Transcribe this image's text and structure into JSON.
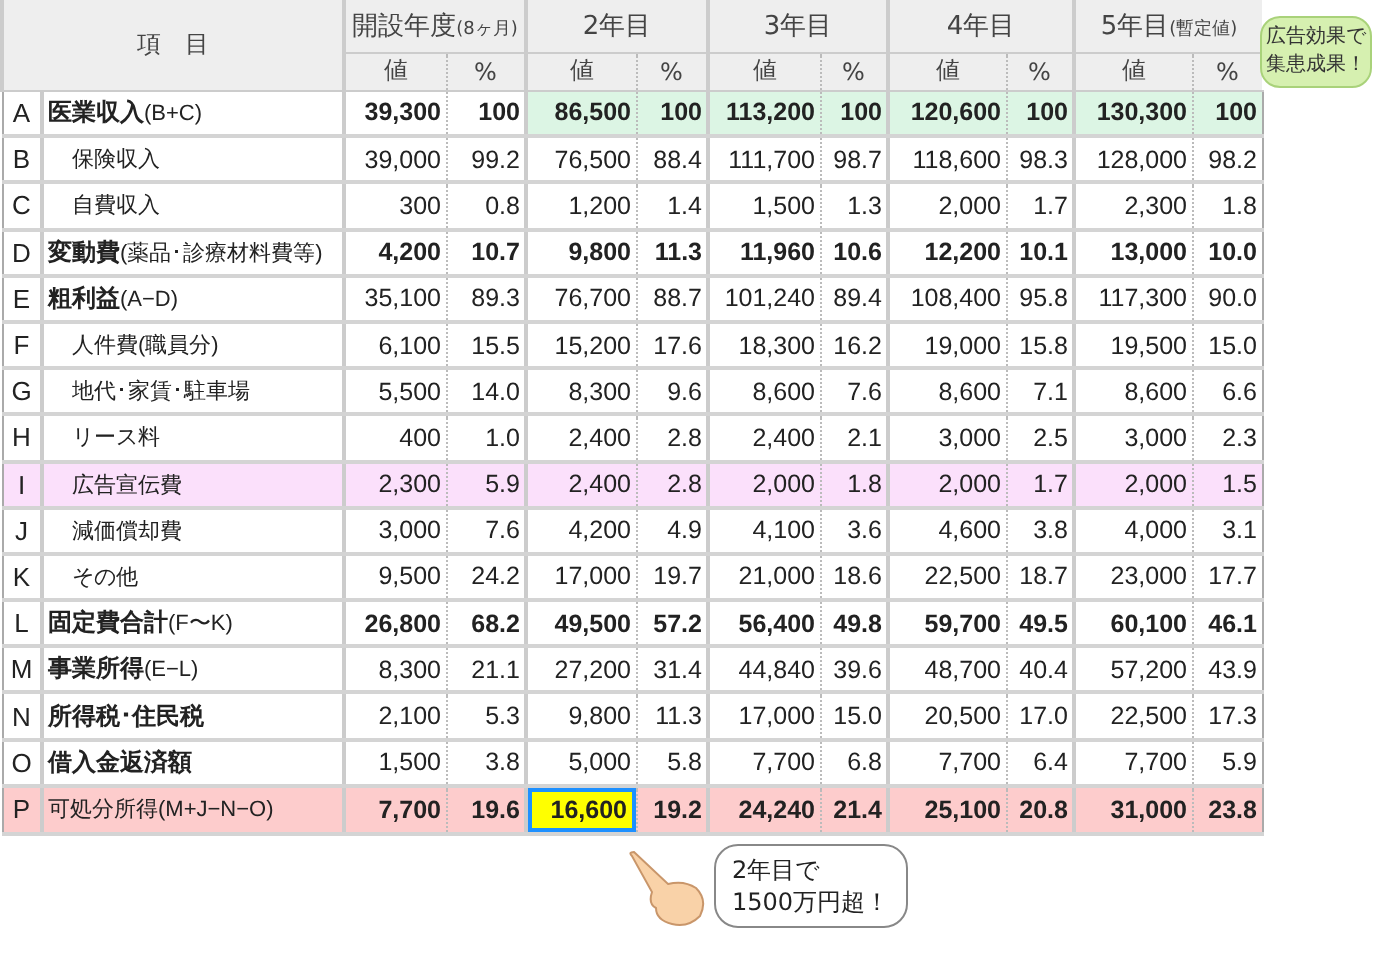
{
  "header": {
    "item": "項　目",
    "years": [
      {
        "title": "開設年度",
        "note": "(8ヶ月)",
        "sub": [
          "値",
          "%"
        ]
      },
      {
        "title": "2年目",
        "sub": [
          "値",
          "%"
        ]
      },
      {
        "title": "3年目",
        "sub": [
          "値",
          "%"
        ]
      },
      {
        "title": "4年目",
        "sub": [
          "値",
          "%"
        ]
      },
      {
        "title": "5年目",
        "note": "(暫定値)",
        "sub": [
          "値",
          "%"
        ]
      }
    ]
  },
  "rows": [
    {
      "letter": "A",
      "label": "**医業収入**(B+C)",
      "indent": false,
      "bold": true,
      "cells": [
        {
          "v": "39,300",
          "boxed": false
        },
        {
          "v": "100",
          "boxed": false
        },
        {
          "v": "86,500",
          "boxed": false,
          "color": "#dcf5e4"
        },
        {
          "v": "100",
          "boxed": false,
          "color": "#dcf5e4"
        },
        {
          "v": "113,200",
          "boxed": false,
          "color": "#dcf5e4"
        },
        {
          "v": "100",
          "boxed": false,
          "color": "#dcf5e4"
        },
        {
          "v": "120,600",
          "boxed": false,
          "color": "#dcf5e4"
        },
        {
          "v": "100",
          "boxed": false,
          "color": "#dcf5e4"
        },
        {
          "v": "130,300",
          "boxed": false,
          "color": "#dcf5e4"
        },
        {
          "v": "100",
          "boxed": false,
          "color": "#dcf5e4"
        }
      ]
    },
    {
      "letter": "B",
      "label": "保険収入",
      "indent": true,
      "bold": false,
      "cells": [
        {
          "v": "39,000",
          "boxed": false
        },
        {
          "v": "99.2",
          "boxed": false
        },
        {
          "v": "76,500",
          "boxed": false
        },
        {
          "v": "88.4",
          "boxed": false
        },
        {
          "v": "111,700",
          "boxed": false
        },
        {
          "v": "98.7",
          "boxed": false
        },
        {
          "v": "118,600",
          "boxed": false
        },
        {
          "v": "98.3",
          "boxed": false
        },
        {
          "v": "128,000",
          "boxed": false
        },
        {
          "v": "98.2",
          "boxed": false
        }
      ]
    },
    {
      "letter": "C",
      "label": "自費収入",
      "indent": true,
      "bold": false,
      "cells": [
        {
          "v": "300",
          "boxed": false
        },
        {
          "v": "0.8",
          "boxed": false
        },
        {
          "v": "1,200",
          "boxed": false
        },
        {
          "v": "1.4",
          "boxed": false
        },
        {
          "v": "1,500",
          "boxed": false
        },
        {
          "v": "1.3",
          "boxed": false
        },
        {
          "v": "2,000",
          "boxed": false
        },
        {
          "v": "1.7",
          "boxed": false
        },
        {
          "v": "2,300",
          "boxed": false
        },
        {
          "v": "1.8",
          "boxed": false
        }
      ]
    },
    {
      "letter": "D",
      "label": "**変動費**(薬品･診療材料費等)",
      "indent": false,
      "bold": true,
      "cells": [
        {
          "v": "4,200",
          "boxed": false
        },
        {
          "v": "10.7",
          "boxed": false
        },
        {
          "v": "9,800",
          "boxed": false
        },
        {
          "v": "11.3",
          "boxed": false
        },
        {
          "v": "11,960",
          "boxed": false
        },
        {
          "v": "10.6",
          "boxed": false
        },
        {
          "v": "12,200",
          "boxed": false
        },
        {
          "v": "10.1",
          "boxed": false
        },
        {
          "v": "13,000",
          "boxed": false
        },
        {
          "v": "10.0",
          "boxed": false
        }
      ]
    },
    {
      "letter": "E",
      "label": "**粗利益**(A−D)",
      "indent": false,
      "bold": false,
      "cells": [
        {
          "v": "35,100",
          "boxed": false
        },
        {
          "v": "89.3",
          "boxed": false
        },
        {
          "v": "76,700",
          "boxed": false
        },
        {
          "v": "88.7",
          "boxed": false
        },
        {
          "v": "101,240",
          "boxed": false
        },
        {
          "v": "89.4",
          "boxed": false
        },
        {
          "v": "108,400",
          "boxed": false
        },
        {
          "v": "95.8",
          "boxed": false
        },
        {
          "v": "117,300",
          "boxed": false
        },
        {
          "v": "90.0",
          "boxed": false
        }
      ]
    },
    {
      "letter": "F",
      "label": "人件費(職員分)",
      "indent": true,
      "bold": false,
      "cells": [
        {
          "v": "6,100",
          "boxed": false
        },
        {
          "v": "15.5",
          "boxed": false
        },
        {
          "v": "15,200",
          "boxed": false
        },
        {
          "v": "17.6",
          "boxed": false
        },
        {
          "v": "18,300",
          "boxed": false
        },
        {
          "v": "16.2",
          "boxed": false
        },
        {
          "v": "19,000",
          "boxed": false
        },
        {
          "v": "15.8",
          "boxed": false
        },
        {
          "v": "19,500",
          "boxed": false
        },
        {
          "v": "15.0",
          "boxed": false
        }
      ]
    },
    {
      "letter": "G",
      "label": "地代･家賃･駐車場",
      "indent": true,
      "bold": false,
      "cells": [
        {
          "v": "5,500",
          "boxed": false
        },
        {
          "v": "14.0",
          "boxed": false
        },
        {
          "v": "8,300",
          "boxed": false
        },
        {
          "v": "9.6",
          "boxed": false
        },
        {
          "v": "8,600",
          "boxed": false
        },
        {
          "v": "7.6",
          "boxed": false
        },
        {
          "v": "8,600",
          "boxed": false
        },
        {
          "v": "7.1",
          "boxed": false
        },
        {
          "v": "8,600",
          "boxed": false
        },
        {
          "v": "6.6",
          "boxed": false
        }
      ]
    },
    {
      "letter": "H",
      "label": "リース料",
      "indent": true,
      "bold": false,
      "cells": [
        {
          "v": "400",
          "boxed": false
        },
        {
          "v": "1.0",
          "boxed": false
        },
        {
          "v": "2,400",
          "boxed": false
        },
        {
          "v": "2.8",
          "boxed": false
        },
        {
          "v": "2,400",
          "boxed": false
        },
        {
          "v": "2.1",
          "boxed": false
        },
        {
          "v": "3,000",
          "boxed": false
        },
        {
          "v": "2.5",
          "boxed": false
        },
        {
          "v": "3,000",
          "boxed": false
        },
        {
          "v": "2.3",
          "boxed": false
        }
      ]
    },
    {
      "letter": "I",
      "label": "広告宣伝費",
      "indent": true,
      "bold": false,
      "color": "#fbe0fb",
      "cells": [
        {
          "v": "2,300",
          "boxed": false
        },
        {
          "v": "5.9",
          "boxed": false
        },
        {
          "v": "2,400",
          "boxed": false
        },
        {
          "v": "2.8",
          "boxed": false
        },
        {
          "v": "2,000",
          "boxed": false
        },
        {
          "v": "1.8",
          "boxed": false
        },
        {
          "v": "2,000",
          "boxed": false
        },
        {
          "v": "1.7",
          "boxed": false
        },
        {
          "v": "2,000",
          "boxed": false
        },
        {
          "v": "1.5",
          "boxed": false
        }
      ]
    },
    {
      "letter": "J",
      "label": "減価償却費",
      "indent": true,
      "bold": false,
      "cells": [
        {
          "v": "3,000",
          "boxed": false
        },
        {
          "v": "7.6",
          "boxed": false
        },
        {
          "v": "4,200",
          "boxed": false
        },
        {
          "v": "4.9",
          "boxed": false
        },
        {
          "v": "4,100",
          "boxed": false
        },
        {
          "v": "3.6",
          "boxed": false
        },
        {
          "v": "4,600",
          "boxed": false
        },
        {
          "v": "3.8",
          "boxed": false
        },
        {
          "v": "4,000",
          "boxed": false
        },
        {
          "v": "3.1",
          "boxed": false
        }
      ]
    },
    {
      "letter": "K",
      "label": "その他",
      "indent": true,
      "bold": false,
      "cells": [
        {
          "v": "9,500",
          "boxed": false
        },
        {
          "v": "24.2",
          "boxed": false
        },
        {
          "v": "17,000",
          "boxed": false
        },
        {
          "v": "19.7",
          "boxed": false
        },
        {
          "v": "21,000",
          "boxed": false
        },
        {
          "v": "18.6",
          "boxed": false
        },
        {
          "v": "22,500",
          "boxed": false
        },
        {
          "v": "18.7",
          "boxed": false
        },
        {
          "v": "23,000",
          "boxed": false
        },
        {
          "v": "17.7",
          "boxed": false
        }
      ]
    },
    {
      "letter": "L",
      "label": "**固定費合計**(F〜K)",
      "indent": false,
      "bold": true,
      "cells": [
        {
          "v": "26,800",
          "boxed": false
        },
        {
          "v": "68.2",
          "boxed": false
        },
        {
          "v": "49,500",
          "boxed": false
        },
        {
          "v": "57.2",
          "boxed": false
        },
        {
          "v": "56,400",
          "boxed": false
        },
        {
          "v": "49.8",
          "boxed": false
        },
        {
          "v": "59,700",
          "boxed": false
        },
        {
          "v": "49.5",
          "boxed": false
        },
        {
          "v": "60,100",
          "boxed": false
        },
        {
          "v": "46.1",
          "boxed": false
        }
      ]
    },
    {
      "letter": "M",
      "label": "**事業所得**(E−L)",
      "indent": false,
      "bold": false,
      "cells": [
        {
          "v": "8,300",
          "boxed": false
        },
        {
          "v": "21.1",
          "boxed": false
        },
        {
          "v": "27,200",
          "boxed": false
        },
        {
          "v": "31.4",
          "boxed": false
        },
        {
          "v": "44,840",
          "boxed": false
        },
        {
          "v": "39.6",
          "boxed": false
        },
        {
          "v": "48,700",
          "boxed": false
        },
        {
          "v": "40.4",
          "boxed": false
        },
        {
          "v": "57,200",
          "boxed": false
        },
        {
          "v": "43.9",
          "boxed": false
        }
      ]
    },
    {
      "letter": "N",
      "label": "**所得税･住民税**",
      "indent": false,
      "bold": false,
      "cells": [
        {
          "v": "2,100",
          "boxed": false
        },
        {
          "v": "5.3",
          "boxed": false
        },
        {
          "v": "9,800",
          "boxed": false
        },
        {
          "v": "11.3",
          "boxed": false
        },
        {
          "v": "17,000",
          "boxed": false
        },
        {
          "v": "15.0",
          "boxed": false
        },
        {
          "v": "20,500",
          "boxed": false
        },
        {
          "v": "17.0",
          "boxed": false
        },
        {
          "v": "22,500",
          "boxed": false
        },
        {
          "v": "17.3",
          "boxed": false
        }
      ]
    },
    {
      "letter": "O",
      "label": "**借入金返済額**",
      "indent": false,
      "bold": false,
      "cells": [
        {
          "v": "1,500",
          "boxed": false
        },
        {
          "v": "3.8",
          "boxed": false
        },
        {
          "v": "5,000",
          "boxed": false
        },
        {
          "v": "5.8",
          "boxed": false
        },
        {
          "v": "7,700",
          "boxed": false
        },
        {
          "v": "6.8",
          "boxed": false
        },
        {
          "v": "7,700",
          "boxed": false
        },
        {
          "v": "6.4",
          "boxed": false
        },
        {
          "v": "7,700",
          "boxed": false
        },
        {
          "v": "5.9",
          "boxed": false
        }
      ]
    },
    {
      "letter": "P",
      "label": "可処分所得(M+J−N−O)",
      "indent": false,
      "bold": true,
      "color": "#fdcccc",
      "cells": [
        {
          "v": "7,700",
          "boxed": false
        },
        {
          "v": "19.6",
          "boxed": false
        },
        {
          "v": "16,600",
          "boxed": true
        },
        {
          "v": "19.2",
          "boxed": false
        },
        {
          "v": "24,240",
          "boxed": false
        },
        {
          "v": "21.4",
          "boxed": false
        },
        {
          "v": "25,100",
          "boxed": false
        },
        {
          "v": "20.8",
          "boxed": false
        },
        {
          "v": "31,000",
          "boxed": false
        },
        {
          "v": "23.8",
          "boxed": false
        }
      ]
    }
  ],
  "callouts": [
    {
      "kind": "top",
      "lines": [
        "広告効果で",
        "集患成果！"
      ]
    },
    {
      "kind": "bottom",
      "lines": [
        "2年目で",
        "1500万円超！"
      ]
    }
  ]
}
